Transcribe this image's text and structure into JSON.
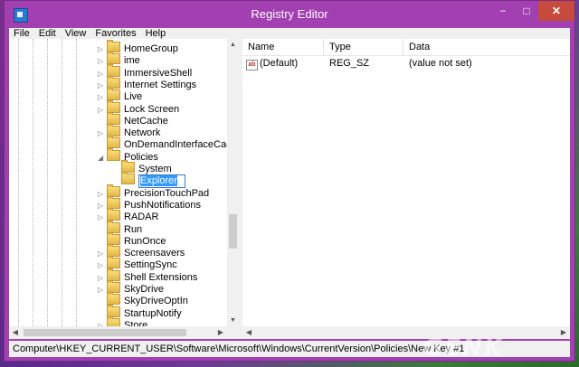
{
  "window": {
    "title": "Registry Editor",
    "min_label": "−",
    "max_label": "□",
    "close_label": "✕"
  },
  "menu": {
    "items": [
      "File",
      "Edit",
      "View",
      "Favorites",
      "Help"
    ]
  },
  "tree": {
    "items": [
      {
        "label": "HomeGroup",
        "arrow": "▷"
      },
      {
        "label": "ime",
        "arrow": "▷"
      },
      {
        "label": "ImmersiveShell",
        "arrow": "▷"
      },
      {
        "label": "Internet Settings",
        "arrow": "▷"
      },
      {
        "label": "Live",
        "arrow": "▷"
      },
      {
        "label": "Lock Screen",
        "arrow": "▷"
      },
      {
        "label": "NetCache",
        "arrow": ""
      },
      {
        "label": "Network",
        "arrow": "▷"
      },
      {
        "label": "OnDemandInterfaceCache",
        "arrow": ""
      },
      {
        "label": "Policies",
        "arrow": "◢"
      },
      {
        "label": "System",
        "arrow": ""
      },
      {
        "label": "Explorer",
        "arrow": "",
        "editing": true
      },
      {
        "label": "PrecisionTouchPad",
        "arrow": "▷"
      },
      {
        "label": "PushNotifications",
        "arrow": "▷"
      },
      {
        "label": "RADAR",
        "arrow": "▷"
      },
      {
        "label": "Run",
        "arrow": ""
      },
      {
        "label": "RunOnce",
        "arrow": ""
      },
      {
        "label": "Screensavers",
        "arrow": "▷"
      },
      {
        "label": "SettingSync",
        "arrow": "▷"
      },
      {
        "label": "Shell Extensions",
        "arrow": "▷"
      },
      {
        "label": "SkyDrive",
        "arrow": "▷"
      },
      {
        "label": "SkyDriveOptIn",
        "arrow": ""
      },
      {
        "label": "StartupNotify",
        "arrow": ""
      },
      {
        "label": "Store",
        "arrow": "▷"
      }
    ]
  },
  "list": {
    "columns": [
      "Name",
      "Type",
      "Data"
    ],
    "rows": [
      {
        "name": "(Default)",
        "type": "REG_SZ",
        "data": "(value not set)",
        "icon": "string-value-icon"
      }
    ]
  },
  "statusbar": {
    "path": "Computer\\HKEY_CURRENT_USER\\Software\\Microsoft\\Windows\\CurrentVersion\\Policies\\New Key #1"
  },
  "watermark": {
    "text": "GENK"
  },
  "colors": {
    "titlebar": "#a23fb1",
    "selection": "#3399ff",
    "close": "#c74b3c"
  }
}
